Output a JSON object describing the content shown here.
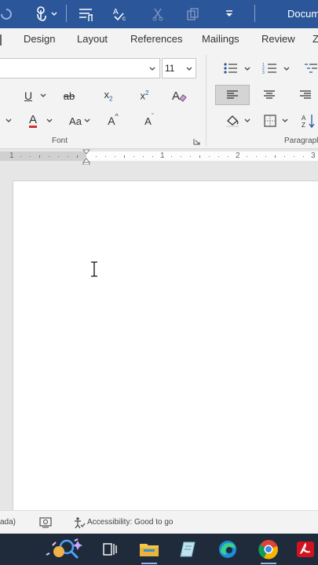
{
  "app": {
    "doc_title": "Docum"
  },
  "tabs": [
    {
      "id": "design",
      "label": "Design"
    },
    {
      "id": "layout",
      "label": "Layout"
    },
    {
      "id": "references",
      "label": "References"
    },
    {
      "id": "mailings",
      "label": "Mailings"
    },
    {
      "id": "review",
      "label": "Review"
    }
  ],
  "ribbon": {
    "font_size": "11",
    "change_case_label": "Aa",
    "grow_font_label": "A",
    "shrink_font_label": "A",
    "font_group_label": "Font",
    "paragraph_group_label": "Paragraph"
  },
  "ruler": {
    "numbers": [
      "1",
      "1",
      "2",
      "3"
    ]
  },
  "statusbar": {
    "language": "ada)",
    "accessibility": "Accessibility: Good to go"
  },
  "colors": {
    "titlebar": "#2b579a",
    "font_color_bar": "#d32f2f",
    "taskbar": "#1f2b3a",
    "ruler_text": "#666666"
  }
}
